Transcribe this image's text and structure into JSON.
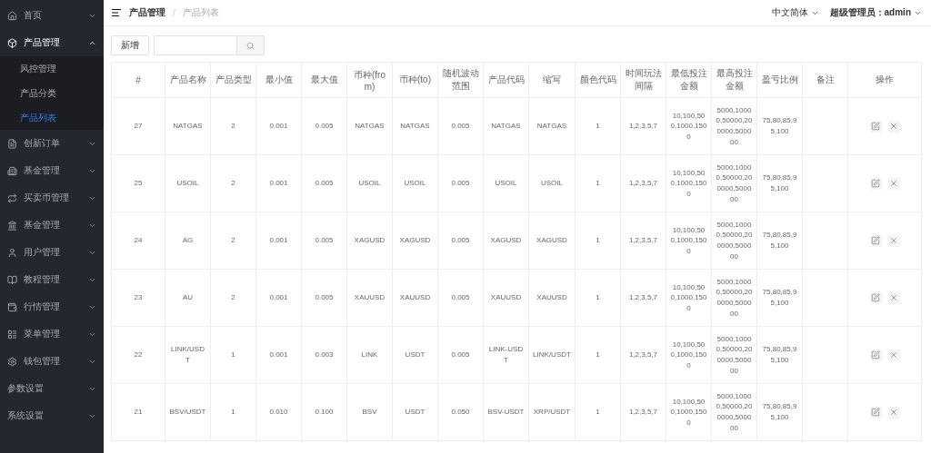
{
  "sidebar": {
    "items": [
      {
        "label": "首页",
        "expanded": false
      },
      {
        "label": "产品管理",
        "expanded": true,
        "children": [
          {
            "label": "风控管理",
            "selected": false
          },
          {
            "label": "产品分类",
            "selected": false
          },
          {
            "label": "产品列表",
            "selected": true
          }
        ]
      },
      {
        "label": "创新订单",
        "expanded": false
      },
      {
        "label": "基金管理",
        "expanded": false
      },
      {
        "label": "买卖币管理",
        "expanded": false
      },
      {
        "label": "基金管理",
        "expanded": false
      },
      {
        "label": "用户管理",
        "expanded": false
      },
      {
        "label": "教程管理",
        "expanded": false
      },
      {
        "label": "行情管理",
        "expanded": false
      },
      {
        "label": "菜单管理",
        "expanded": false
      },
      {
        "label": "钱包管理",
        "expanded": false
      },
      {
        "label": "参数设置",
        "expanded": false
      },
      {
        "label": "系统设置",
        "expanded": false
      }
    ]
  },
  "header": {
    "breadcrumb": [
      "产品管理",
      "产品列表"
    ],
    "breadcrumb_separator": "/",
    "language": "中文简体",
    "user": "超级管理员：admin"
  },
  "toolbar": {
    "add_button": "新增"
  },
  "table": {
    "columns": [
      {
        "label": "#",
        "kind": "data"
      },
      {
        "label": "产品名称",
        "kind": "data"
      },
      {
        "label": "产品类型",
        "kind": "data"
      },
      {
        "label": "最小值",
        "kind": "data"
      },
      {
        "label": "最大值",
        "kind": "data"
      },
      {
        "label": "币种(from)",
        "kind": "data"
      },
      {
        "label": "币种(to)",
        "kind": "data"
      },
      {
        "label": "随机波动范围",
        "kind": "data"
      },
      {
        "label": "产品代码",
        "kind": "data"
      },
      {
        "label": "缩写",
        "kind": "data"
      },
      {
        "label": "颜色代码",
        "kind": "data"
      },
      {
        "label": "时间玩法间隔",
        "kind": "data"
      },
      {
        "label": "最低投注金额",
        "kind": "data"
      },
      {
        "label": "最高投注金额",
        "kind": "data"
      },
      {
        "label": "盈亏比例",
        "kind": "data"
      },
      {
        "label": "备注",
        "kind": "remark"
      },
      {
        "label": "操作",
        "kind": "actions"
      }
    ],
    "rows": [
      {
        "cells": [
          "27",
          "NATGAS",
          "2",
          "0.001",
          "0.005",
          "NATGAS",
          "NATGAS",
          "0.005",
          "NATGAS",
          "NATGAS",
          "1",
          "1,2,3,5,7",
          "10,100,500,1000,1500",
          "5000,10000,50000,200000,500000",
          "75,80,85,95,100"
        ]
      },
      {
        "cells": [
          "25",
          "USOIL",
          "2",
          "0.001",
          "0.005",
          "USOIL",
          "USOIL",
          "0.005",
          "USOIL",
          "USOIL",
          "1",
          "1,2,3,5,7",
          "10,100,500,1000,1500",
          "5000,10000,50000,200000,500000",
          "75,80,85,95,100"
        ]
      },
      {
        "cells": [
          "24",
          "AG",
          "2",
          "0.001",
          "0.005",
          "XAGUSD",
          "XAGUSD",
          "0.005",
          "XAGUSD",
          "XAGUSD",
          "1",
          "1,2,3,5,7",
          "10,100,500,1000,1500",
          "5000,10000,50000,200000,500000",
          "75,80,85,95,100"
        ]
      },
      {
        "cells": [
          "23",
          "AU",
          "2",
          "0.001",
          "0.005",
          "XAUUSD",
          "XAUUSD",
          "0.005",
          "XAUUSD",
          "XAUUSD",
          "1",
          "1,2,3,5,7",
          "10,100,500,1000,1500",
          "5000,10000,50000,200000,500000",
          "75,80,85,95,100"
        ]
      },
      {
        "cells": [
          "22",
          "LINK/USDT",
          "1",
          "0.001",
          "0.003",
          "LINK",
          "USDT",
          "0.005",
          "LINK-USDT",
          "LINK/USDT",
          "1",
          "1,2,3,5,7",
          "10,100,500,1000,1500",
          "5000,10000,50000,200000,500000",
          "75,80,85,95,100"
        ]
      },
      {
        "cells": [
          "21",
          "BSV/USDT",
          "1",
          "0.010",
          "0.100",
          "BSV",
          "USDT",
          "0.050",
          "BSV-USDT",
          "XRP/USDT",
          "1",
          "1,2,3,5,7",
          "10,100,500,1000,1500",
          "5000,10000,50000,200000,500000",
          "75,80,85,95,100"
        ]
      }
    ]
  }
}
